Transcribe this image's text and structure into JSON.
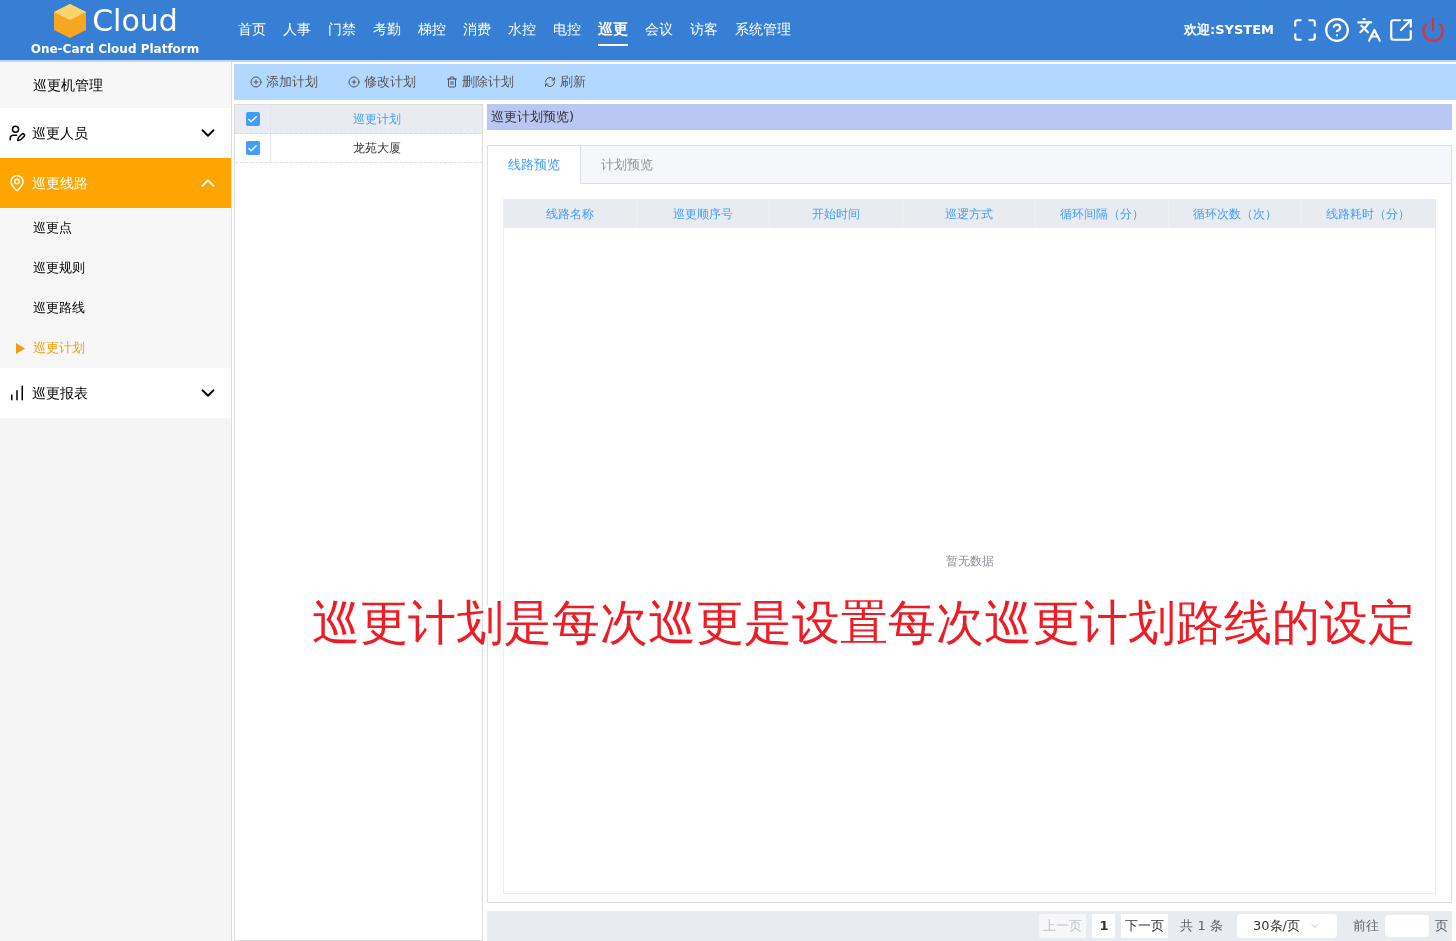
{
  "header": {
    "logo_text": "Cloud",
    "logo_subtitle": "One-Card Cloud Platform",
    "nav": [
      {
        "label": "首页",
        "selected": false
      },
      {
        "label": "人事",
        "selected": false
      },
      {
        "label": "门禁",
        "selected": false
      },
      {
        "label": "考勤",
        "selected": false
      },
      {
        "label": "梯控",
        "selected": false
      },
      {
        "label": "消费",
        "selected": false
      },
      {
        "label": "水控",
        "selected": false
      },
      {
        "label": "电控",
        "selected": false
      },
      {
        "label": "巡更",
        "selected": true
      },
      {
        "label": "会议",
        "selected": false
      },
      {
        "label": "访客",
        "selected": false
      },
      {
        "label": "系统管理",
        "selected": false
      }
    ],
    "welcome": "欢迎:SYSTEM"
  },
  "sidebar": {
    "items": [
      {
        "kind": "plain",
        "label": "巡更机管理"
      },
      {
        "kind": "group",
        "label": "巡更人员",
        "expanded": false
      },
      {
        "kind": "group",
        "label": "巡更线路",
        "expanded": true,
        "children": [
          {
            "label": "巡更点",
            "selected": false
          },
          {
            "label": "巡更规则",
            "selected": false
          },
          {
            "label": "巡更路线",
            "selected": false
          },
          {
            "label": "巡更计划",
            "selected": true
          }
        ]
      },
      {
        "kind": "group",
        "label": "巡更报表",
        "expanded": false
      }
    ]
  },
  "toolbar": [
    {
      "kind": "add",
      "label": "添加计划"
    },
    {
      "kind": "edit",
      "label": "修改计划"
    },
    {
      "kind": "delete",
      "label": "删除计划"
    },
    {
      "kind": "refresh",
      "label": "刷新"
    }
  ],
  "plan_list": [
    {
      "label": "巡更计划",
      "checked": true,
      "selected": true
    },
    {
      "label": "龙苑大厦",
      "checked": true,
      "selected": false
    }
  ],
  "preview": {
    "title": "巡更计划预览)",
    "tabs": [
      {
        "label": "线路预览",
        "selected": true
      },
      {
        "label": "计划预览",
        "selected": false
      }
    ],
    "columns": [
      "线路名称",
      "巡更顺序号",
      "开始时间",
      "巡逻方式",
      "循环间隔（分）",
      "循环次数（次）",
      "线路耗时（分）"
    ],
    "empty_text": "暂无数据"
  },
  "pagination": {
    "prev": "上一页",
    "page": "1",
    "next": "下一页",
    "total": "共 1 条",
    "page_size": "30条/页",
    "goto": "前往",
    "page_unit": "页"
  },
  "caption": "巡更计划是每次巡更是设置每次巡更计划路线的设定"
}
